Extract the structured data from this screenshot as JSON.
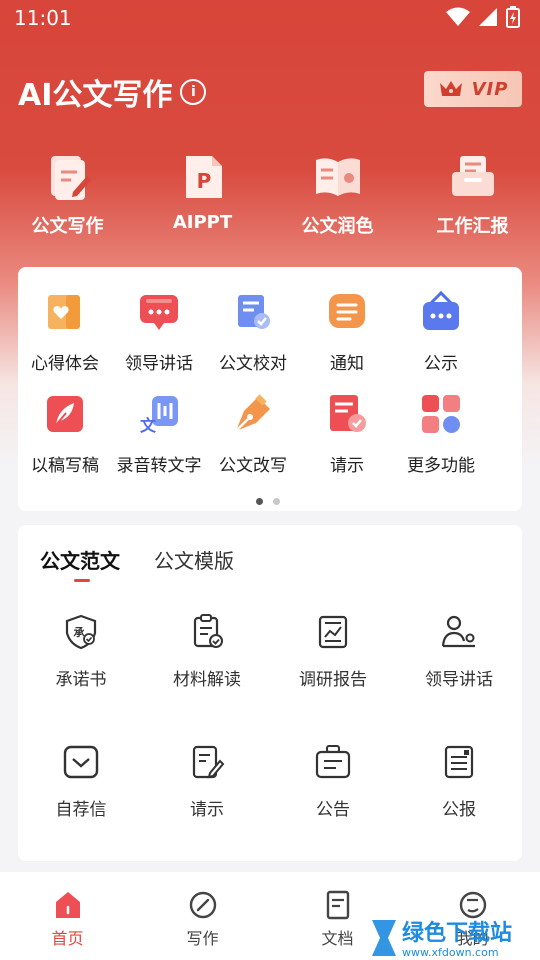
{
  "status": {
    "time": "11:01"
  },
  "header": {
    "title": "AI公文写作",
    "vip_label": "VIP"
  },
  "top_tools": [
    {
      "label": "公文写作",
      "icon": "notebook-pen-icon"
    },
    {
      "label": "AIPPT",
      "icon": "ppt-file-icon"
    },
    {
      "label": "公文润色",
      "icon": "open-book-icon"
    },
    {
      "label": "工作汇报",
      "icon": "report-tray-icon"
    }
  ],
  "tools_row1": [
    {
      "label": "心得体会",
      "icon": "heart-notebook-icon"
    },
    {
      "label": "领导讲话",
      "icon": "speech-bubble-icon"
    },
    {
      "label": "公文校对",
      "icon": "check-document-icon"
    },
    {
      "label": "通知",
      "icon": "notice-icon"
    },
    {
      "label": "公示",
      "icon": "hanging-board-icon"
    }
  ],
  "tools_row2": [
    {
      "label": "以稿写稿",
      "icon": "feather-icon"
    },
    {
      "label": "录音转文字",
      "icon": "voice-to-text-icon"
    },
    {
      "label": "公文改写",
      "icon": "fountain-pen-icon"
    },
    {
      "label": "请示",
      "icon": "approval-doc-icon"
    },
    {
      "label": "更多功能",
      "icon": "more-apps-icon"
    }
  ],
  "samples": {
    "tabs": [
      "公文范文",
      "公文模版"
    ],
    "row1": [
      {
        "label": "承诺书",
        "icon": "promise-shield-icon"
      },
      {
        "label": "材料解读",
        "icon": "clipboard-check-icon"
      },
      {
        "label": "调研报告",
        "icon": "chart-report-icon"
      },
      {
        "label": "领导讲话",
        "icon": "speaker-podium-icon"
      }
    ],
    "row2": [
      {
        "label": "自荐信",
        "icon": "envelope-icon"
      },
      {
        "label": "请示",
        "icon": "edit-document-icon"
      },
      {
        "label": "公告",
        "icon": "announcement-box-icon"
      },
      {
        "label": "公报",
        "icon": "bulletin-icon"
      }
    ]
  },
  "nav": [
    {
      "label": "首页",
      "icon": "home-icon",
      "active": true
    },
    {
      "label": "写作",
      "icon": "compass-icon"
    },
    {
      "label": "文档",
      "icon": "document-icon"
    },
    {
      "label": "我的",
      "icon": "profile-icon"
    }
  ],
  "watermark": {
    "text": "绿色下载站",
    "url": "www.xfdown.com"
  },
  "colors": {
    "brand_red": "#d8453a",
    "accent": "#e0483c"
  }
}
